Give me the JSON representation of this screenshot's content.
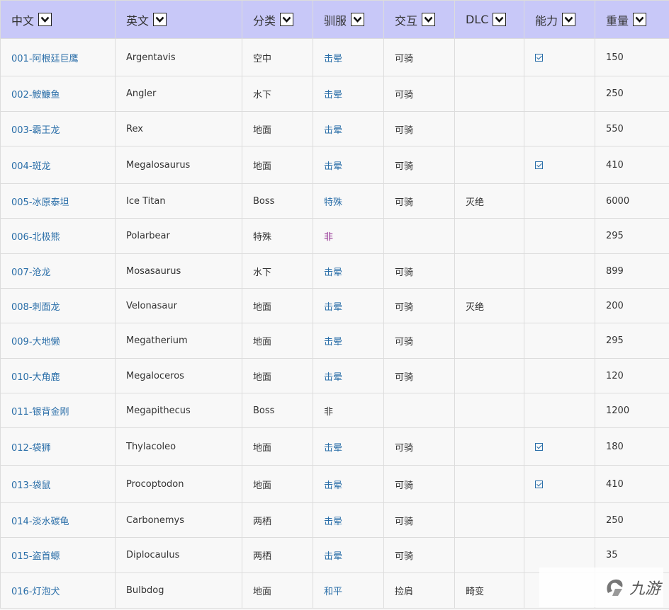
{
  "columns": [
    {
      "key": "zh",
      "label": "中文"
    },
    {
      "key": "en",
      "label": "英文"
    },
    {
      "key": "cat",
      "label": "分类"
    },
    {
      "key": "tame",
      "label": "驯服"
    },
    {
      "key": "inter",
      "label": "交互"
    },
    {
      "key": "dlc",
      "label": "DLC"
    },
    {
      "key": "ability",
      "label": "能力"
    },
    {
      "key": "weight",
      "label": "重量"
    }
  ],
  "rows": [
    {
      "zh": "001-阿根廷巨鹰",
      "en": "Argentavis",
      "cat": "空中",
      "tame": "击晕",
      "inter": "可骑",
      "dlc": "",
      "ability": true,
      "weight": "150"
    },
    {
      "zh": "002-鮟鱇鱼",
      "en": "Angler",
      "cat": "水下",
      "tame": "击晕",
      "inter": "可骑",
      "dlc": "",
      "ability": false,
      "weight": "250"
    },
    {
      "zh": "003-霸王龙",
      "en": "Rex",
      "cat": "地面",
      "tame": "击晕",
      "inter": "可骑",
      "dlc": "",
      "ability": false,
      "weight": "550"
    },
    {
      "zh": "004-斑龙",
      "en": "Megalosaurus",
      "cat": "地面",
      "tame": "击晕",
      "inter": "可骑",
      "dlc": "",
      "ability": true,
      "weight": "410"
    },
    {
      "zh": "005-冰原泰坦",
      "en": "Ice Titan",
      "cat": "Boss",
      "tame": "特殊",
      "inter": "可骑",
      "dlc": "灭绝",
      "ability": false,
      "weight": "6000"
    },
    {
      "zh": "006-北极熊",
      "en": "Polarbear",
      "cat": "特殊",
      "tame": "非",
      "inter": "",
      "dlc": "",
      "ability": false,
      "weight": "295"
    },
    {
      "zh": "007-沧龙",
      "en": "Mosasaurus",
      "cat": "水下",
      "tame": "击晕",
      "inter": "可骑",
      "dlc": "",
      "ability": false,
      "weight": "899"
    },
    {
      "zh": "008-刺面龙",
      "en": "Velonasaur",
      "cat": "地面",
      "tame": "击晕",
      "inter": "可骑",
      "dlc": "灭绝",
      "ability": false,
      "weight": "200"
    },
    {
      "zh": "009-大地懒",
      "en": "Megatherium",
      "cat": "地面",
      "tame": "击晕",
      "inter": "可骑",
      "dlc": "",
      "ability": false,
      "weight": "295"
    },
    {
      "zh": "010-大角鹿",
      "en": "Megaloceros",
      "cat": "地面",
      "tame": "击晕",
      "inter": "可骑",
      "dlc": "",
      "ability": false,
      "weight": "120"
    },
    {
      "zh": "011-银背金刚",
      "en": "Megapithecus",
      "cat": "Boss",
      "tame": "非",
      "inter": "",
      "dlc": "",
      "ability": false,
      "weight": "1200"
    },
    {
      "zh": "012-袋狮",
      "en": "Thylacoleo",
      "cat": "地面",
      "tame": "击晕",
      "inter": "可骑",
      "dlc": "",
      "ability": true,
      "weight": "180"
    },
    {
      "zh": "013-袋鼠",
      "en": "Procoptodon",
      "cat": "地面",
      "tame": "击晕",
      "inter": "可骑",
      "dlc": "",
      "ability": true,
      "weight": "410"
    },
    {
      "zh": "014-淡水碳龟",
      "en": "Carbonemys",
      "cat": "两栖",
      "tame": "击晕",
      "inter": "可骑",
      "dlc": "",
      "ability": false,
      "weight": "250"
    },
    {
      "zh": "015-盗首螈",
      "en": "Diplocaulus",
      "cat": "两栖",
      "tame": "击晕",
      "inter": "可骑",
      "dlc": "",
      "ability": false,
      "weight": "35"
    },
    {
      "zh": "016-灯泡犬",
      "en": "Bulbdog",
      "cat": "地面",
      "tame": "和平",
      "inter": "捡肩",
      "dlc": "畸变",
      "ability": false,
      "weight": ""
    }
  ],
  "tame_link_style": {
    "击晕": "link",
    "特殊": "link",
    "和平": "link",
    "非_006": "link-purple"
  },
  "watermark": {
    "text": "九游",
    "icon": "jiuyou-logo-icon"
  },
  "colors": {
    "header_bg": "#c8c8f8",
    "link": "#2a6ea8",
    "visited_link": "#8a1f8a",
    "border": "#dcdcdc"
  }
}
